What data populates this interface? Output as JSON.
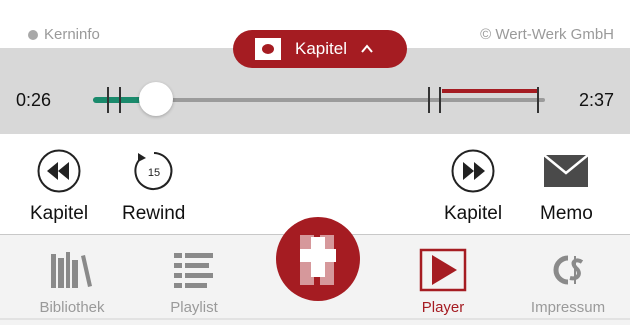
{
  "header": {
    "left_label": "Kerninfo",
    "right_label": "© Wert-Werk GmbH"
  },
  "chapter_pill": {
    "label": "Kapitel"
  },
  "progress": {
    "elapsed": "0:26",
    "total": "2:37",
    "played_fraction": 0.14
  },
  "controls": {
    "prev_chapter_label": "Kapitel",
    "rewind_label": "Rewind",
    "rewind_seconds": "15",
    "next_chapter_label": "Kapitel",
    "memo_label": "Memo"
  },
  "tabs": [
    {
      "label": "Bibliothek",
      "icon": "books-icon"
    },
    {
      "label": "Playlist",
      "icon": "list-icon"
    },
    {
      "label": "Player",
      "icon": "play-icon",
      "active": true
    },
    {
      "label": "Impressum",
      "icon": "copyright-icon"
    }
  ],
  "colors": {
    "accent": "#a51c22",
    "played": "#1a8a6c",
    "band": "#d8d8d8"
  }
}
